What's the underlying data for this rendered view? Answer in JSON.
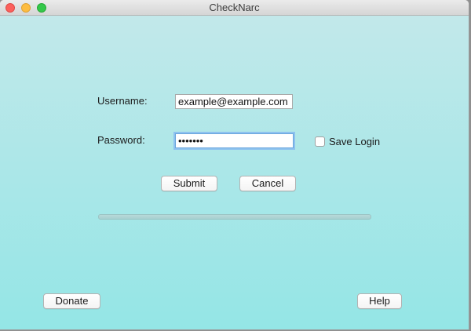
{
  "window": {
    "title": "CheckNarc"
  },
  "form": {
    "username_label": "Username:",
    "username_value": "example@example.com",
    "password_label": "Password:",
    "password_value": "•••••••",
    "save_login_label": "Save Login",
    "save_login_checked": false
  },
  "actions": {
    "submit_label": "Submit",
    "cancel_label": "Cancel",
    "donate_label": "Donate",
    "help_label": "Help"
  },
  "progress": {
    "value": 0
  },
  "colors": {
    "background_top": "#c2e8ea",
    "background_bottom": "#94e6e6",
    "focus_ring": "#8ec2ef",
    "close": "#fc605c",
    "minimize": "#fdbc40",
    "zoom": "#34c84a"
  }
}
